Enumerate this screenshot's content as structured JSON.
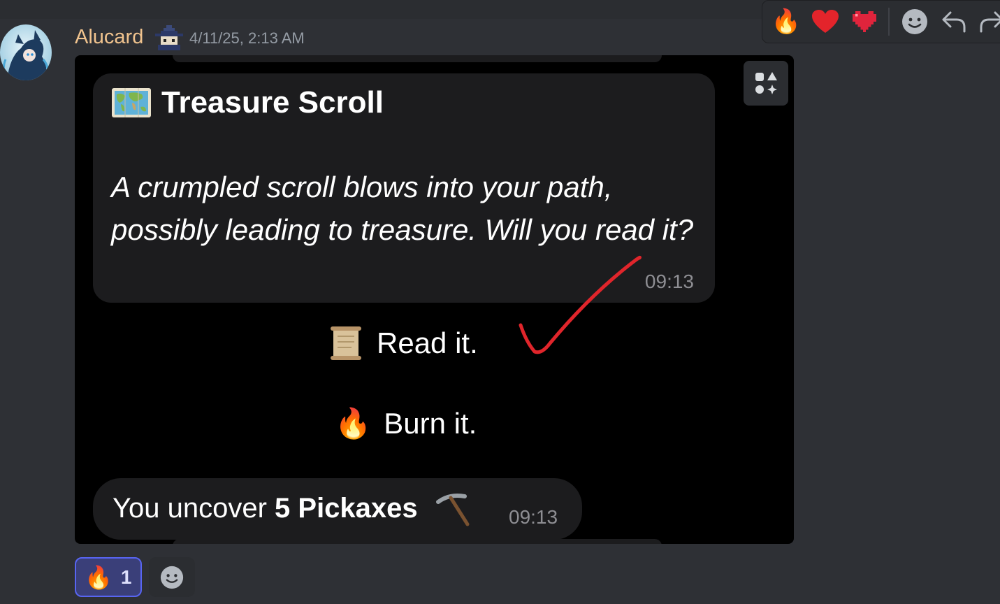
{
  "message": {
    "author": "Alucard",
    "timestamp": "4/11/25, 2:13 AM",
    "badge_icon": "wizard-badge-icon"
  },
  "toolbar": {
    "reactions": [
      "🔥",
      "❤️"
    ],
    "buttons": [
      "pixel-heart-icon",
      "add-reaction-icon",
      "reply-icon",
      "forward-icon"
    ]
  },
  "attachment": {
    "bubble1": {
      "title": "Treasure Scroll",
      "body": "A crumpled scroll blows into your path, possibly leading to treasure. Will you read it?",
      "time": "09:13"
    },
    "choices": [
      {
        "icon": "scroll-icon",
        "label": "Read it."
      },
      {
        "icon": "🔥",
        "label": "Burn it."
      }
    ],
    "bubble2": {
      "prefix": "You uncover ",
      "bold": "5 Pickaxes",
      "time": "09:13"
    }
  },
  "reactions": [
    {
      "emoji": "🔥",
      "count": "1"
    }
  ],
  "colors": {
    "username": "#f0c38e",
    "background": "#313338",
    "reaction_active_bg": "#3a3f79",
    "reaction_active_border": "#5865f2",
    "checkmark": "#e0252b"
  }
}
